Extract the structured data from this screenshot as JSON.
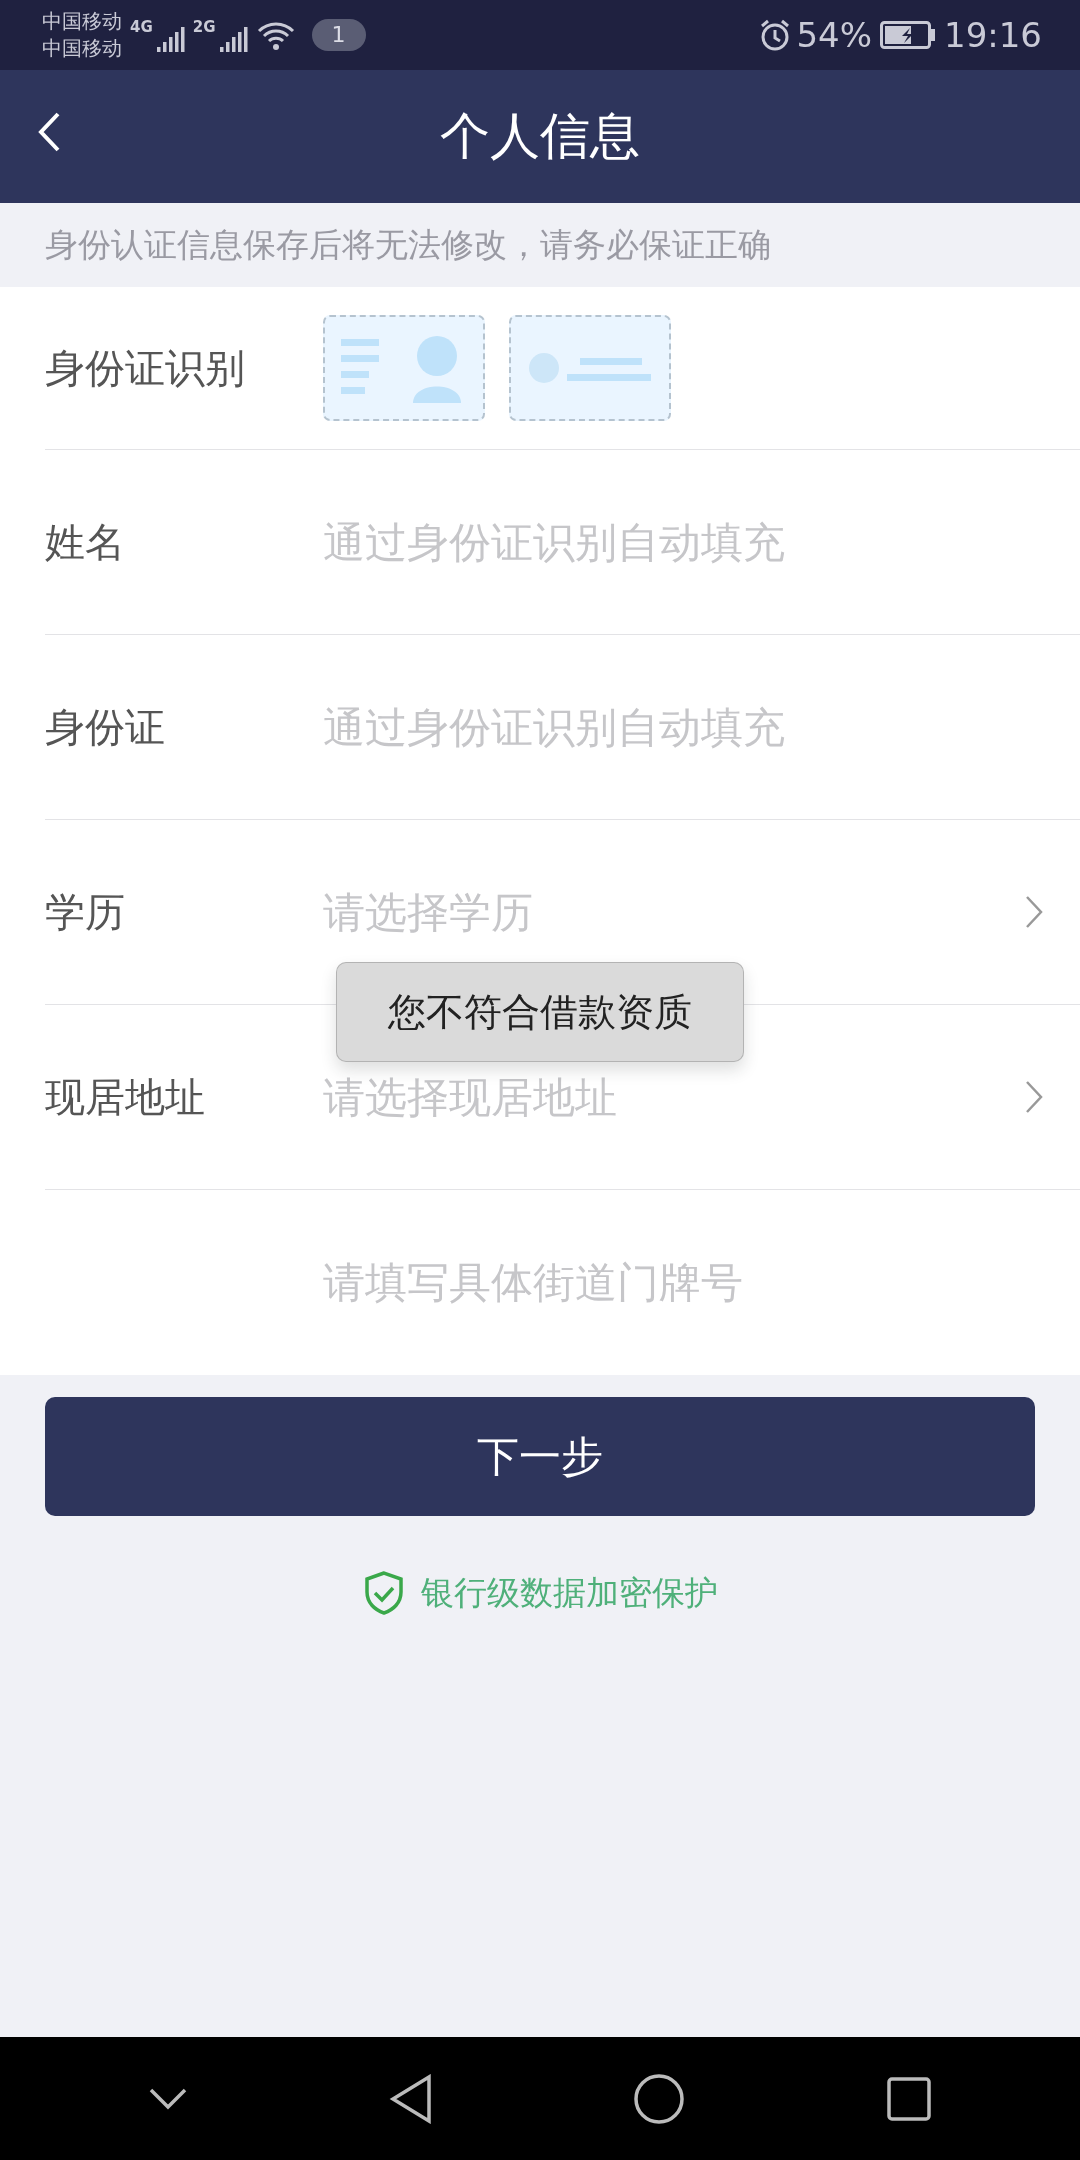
{
  "status_bar": {
    "carriers": [
      "中国移动",
      "中国移动"
    ],
    "network_1": "4G",
    "network_2": "2G",
    "notification_count": "1",
    "battery": "54%",
    "time": "19:16"
  },
  "header": {
    "title": "个人信息"
  },
  "notice": "身份认证信息保存后将无法修改，请务必保证正确",
  "rows": [
    {
      "kind": "idscan",
      "label": "身份证识别"
    },
    {
      "kind": "input",
      "label": "姓名",
      "placeholder": "通过身份证识别自动填充"
    },
    {
      "kind": "input",
      "label": "身份证",
      "placeholder": "通过身份证识别自动填充"
    },
    {
      "kind": "select",
      "label": "学历",
      "placeholder": "请选择学历"
    },
    {
      "kind": "select",
      "label": "现居地址",
      "placeholder": "请选择现居地址"
    },
    {
      "kind": "input",
      "placeholder": "请填写具体街道门牌号"
    }
  ],
  "next_button": "下一步",
  "security_note": "银行级数据加密保护",
  "toast": "您不符合借款资质"
}
